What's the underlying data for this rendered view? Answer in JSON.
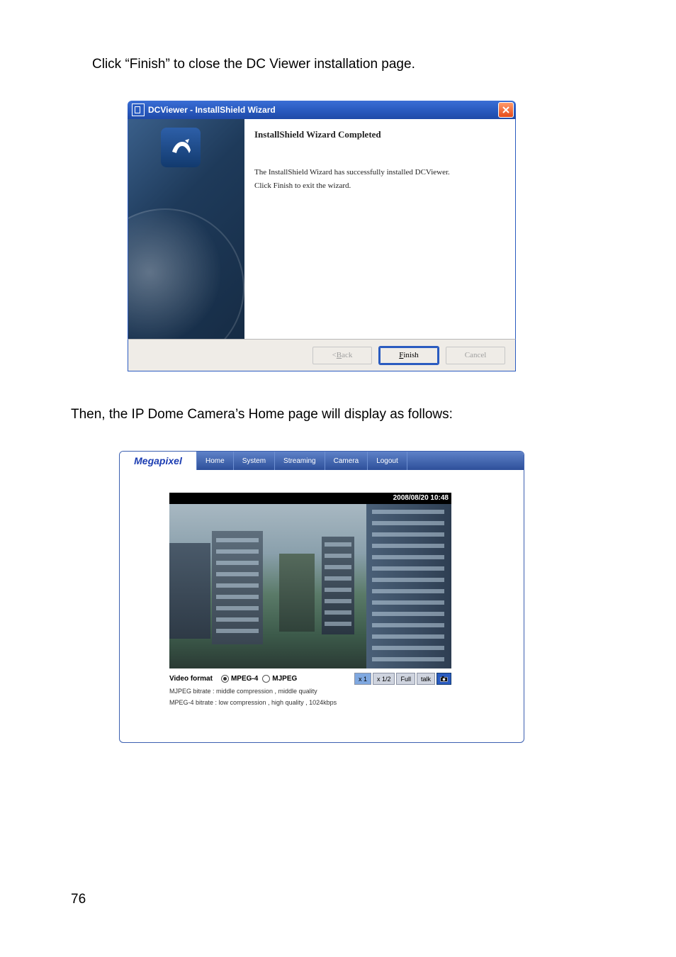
{
  "instr1": "Click “Finish” to close the DC Viewer installation page.",
  "instr2": "Then, the IP Dome Camera’s Home page will display as follows:",
  "pagenum": "76",
  "installer": {
    "title": "DCViewer - InstallShield Wizard",
    "heading": "InstallShield Wizard Completed",
    "text1": "The InstallShield Wizard has successfully installed DCViewer.",
    "text2": "Click Finish to exit the wizard.",
    "back_pre": "< ",
    "back_u": "B",
    "back_post": "ack",
    "finish_u": "F",
    "finish_post": "inish",
    "cancel": "Cancel"
  },
  "camera": {
    "brand": "Megapixel",
    "tabs": [
      "Home",
      "System",
      "Streaming",
      "Camera",
      "Logout"
    ],
    "timestamp": "2008/08/20 10:48",
    "vf_label": "Video format",
    "opt1": "MPEG-4",
    "opt2": "MJPEG",
    "btns": [
      "x 1",
      "x 1/2",
      "Full",
      "talk"
    ],
    "stat1": "MJPEG bitrate : middle compression , middle quality",
    "stat2": "MPEG-4 bitrate : low compression , high quality , 1024kbps"
  }
}
